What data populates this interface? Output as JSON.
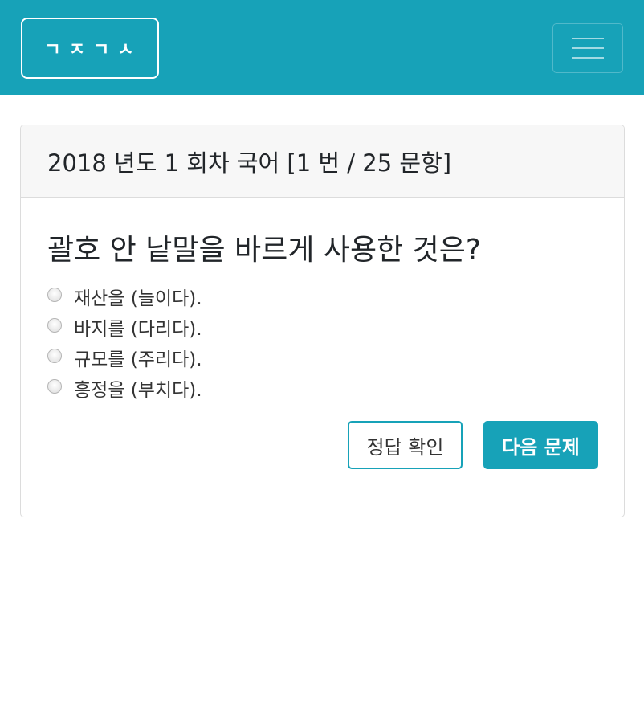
{
  "navbar": {
    "brand": "ㄱㅈㄱㅅ",
    "menu_icon": "hamburger-menu-icon",
    "color": "#17a2b8"
  },
  "card": {
    "header": "2018 년도 1 회차 국어 [1 번 / 25 문항]",
    "question": "괄호 안 낱말을 바르게 사용한 것은?",
    "options": [
      {
        "label": "재산을 (늘이다).",
        "selected": false
      },
      {
        "label": "바지를 (다리다).",
        "selected": false
      },
      {
        "label": "규모를 (주리다).",
        "selected": false
      },
      {
        "label": "흥정을 (부치다).",
        "selected": false
      }
    ],
    "check_answer_label": "정답 확인",
    "next_question_label": "다음 문제"
  }
}
